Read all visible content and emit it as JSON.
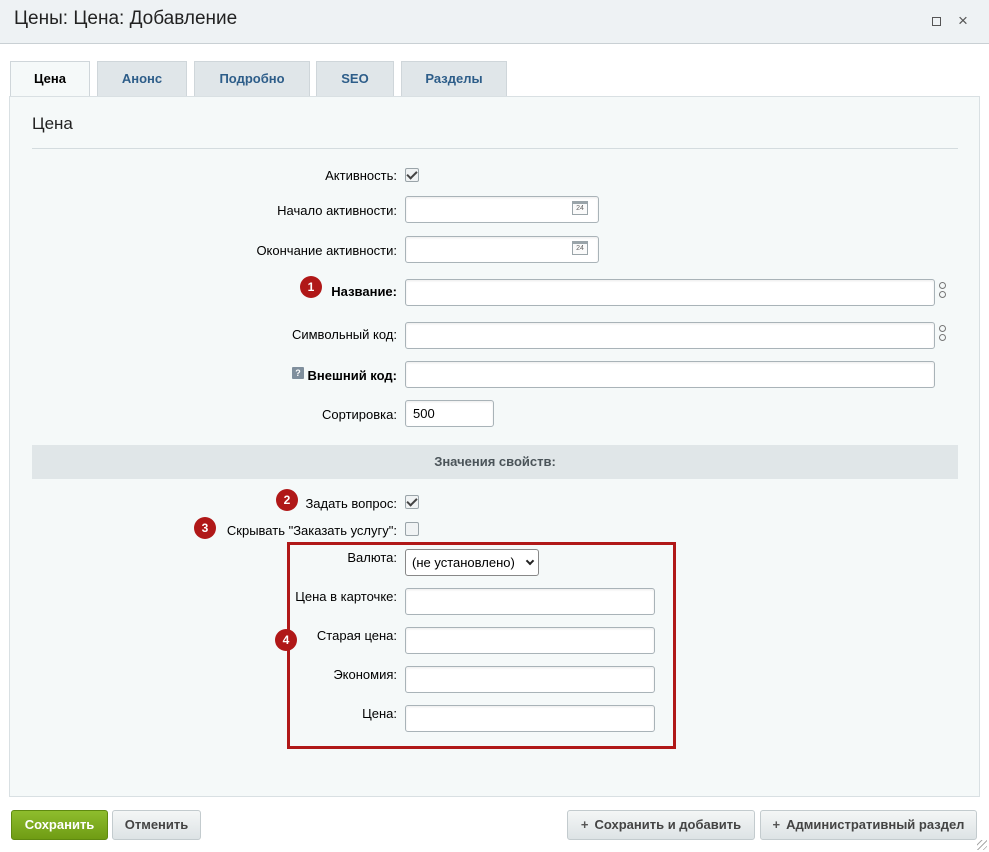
{
  "window": {
    "title": "Цены: Цена: Добавление",
    "maximize_icon": "maximize-icon",
    "close_label": "×"
  },
  "tabs": [
    {
      "label": "Цена",
      "active": true
    },
    {
      "label": "Анонс",
      "active": false
    },
    {
      "label": "Подробно",
      "active": false
    },
    {
      "label": "SEO",
      "active": false
    },
    {
      "label": "Разделы",
      "active": false
    }
  ],
  "panel": {
    "title": "Цена"
  },
  "fields": {
    "activity": {
      "label": "Активность:",
      "checked": true
    },
    "active_from": {
      "label": "Начало активности:",
      "value": "",
      "calendar_label": "24"
    },
    "active_to": {
      "label": "Окончание активности:",
      "value": "",
      "calendar_label": "24"
    },
    "name": {
      "label": "Название:",
      "value": "",
      "badge": "1"
    },
    "code": {
      "label": "Символьный код:",
      "value": ""
    },
    "external_code": {
      "label": "Внешний код:",
      "value": "",
      "help": "?"
    },
    "sort": {
      "label": "Сортировка:",
      "value": "500"
    }
  },
  "properties": {
    "header": "Значения свойств:",
    "ask_question": {
      "label": "Задать вопрос:",
      "checked": true,
      "badge": "2"
    },
    "hide_order": {
      "label": "Скрывать \"Заказать услугу\":",
      "checked": false,
      "badge": "3"
    },
    "currency": {
      "label": "Валюта:",
      "selected": "(не установлено)"
    },
    "card_price": {
      "label": "Цена в карточке:",
      "value": ""
    },
    "old_price": {
      "label": "Старая цена:",
      "value": ""
    },
    "savings": {
      "label": "Экономия:",
      "value": ""
    },
    "price": {
      "label": "Цена:",
      "value": ""
    },
    "group_badge": "4",
    "highlight_color": "#b01818"
  },
  "footer": {
    "save": "Сохранить",
    "cancel": "Отменить",
    "save_add": "Сохранить и добавить",
    "admin_section": "Административный раздел",
    "plus": "+"
  },
  "colors": {
    "primary_button": "#7aa81e",
    "tab_text": "#2d5d89",
    "badge": "#b01818"
  }
}
